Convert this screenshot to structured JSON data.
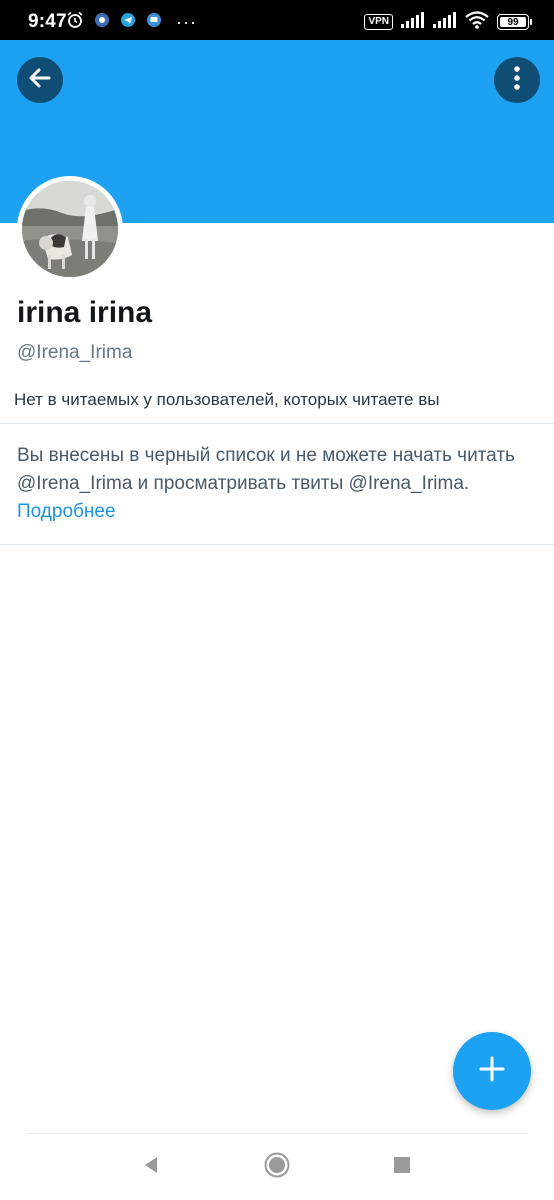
{
  "status_bar": {
    "time": "9:47",
    "vpn_label": "VPN",
    "battery_level": "99",
    "more_indicator": "···",
    "left_icons": [
      "alarm-icon",
      "app-notification-icon",
      "telegram-icon",
      "message-icon"
    ],
    "right_icons": [
      "signal-icon",
      "signal-icon",
      "wifi-icon",
      "battery-icon"
    ]
  },
  "header": {
    "banner_color": "#1da1f2",
    "back_icon": "back-arrow-icon",
    "more_icon": "more-vertical-icon"
  },
  "profile": {
    "display_name": "irina irina",
    "handle": "@Irena_Irima",
    "followers_note": "Нет в читаемых у пользователей, которых читаете вы"
  },
  "blocked_notice": {
    "text": "Вы внесены в черный список и не можете начать читать @Irena_Irima и просматривать твиты @Irena_Irima.",
    "link_text": "Подробнее",
    "link_color": "#1b95e0"
  },
  "fab": {
    "icon": "plus-icon",
    "color": "#1da1f2"
  },
  "nav_bar": {
    "back_icon": "nav-back-icon",
    "home_icon": "nav-home-icon",
    "recents_icon": "nav-recents-icon"
  }
}
